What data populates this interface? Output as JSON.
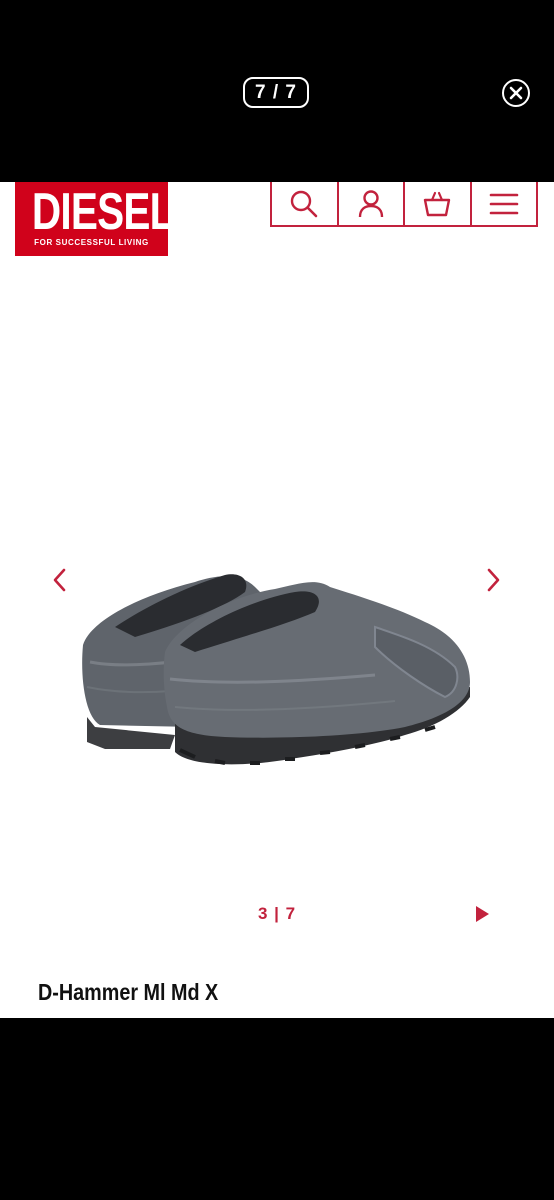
{
  "viewer": {
    "counter": "7 / 7"
  },
  "header": {
    "logo_text": "DIESEL",
    "logo_tagline": "FOR SUCCESSFUL LIVING"
  },
  "gallery": {
    "pager": "3 | 7"
  },
  "product": {
    "name": "D-Hammer Ml Md X"
  },
  "colors": {
    "brand_red": "#d0021b",
    "accent": "#c2223d"
  },
  "icons": [
    "close-icon",
    "search-icon",
    "account-icon",
    "basket-icon",
    "menu-icon",
    "chevron-left-icon",
    "chevron-right-icon",
    "play-icon"
  ]
}
